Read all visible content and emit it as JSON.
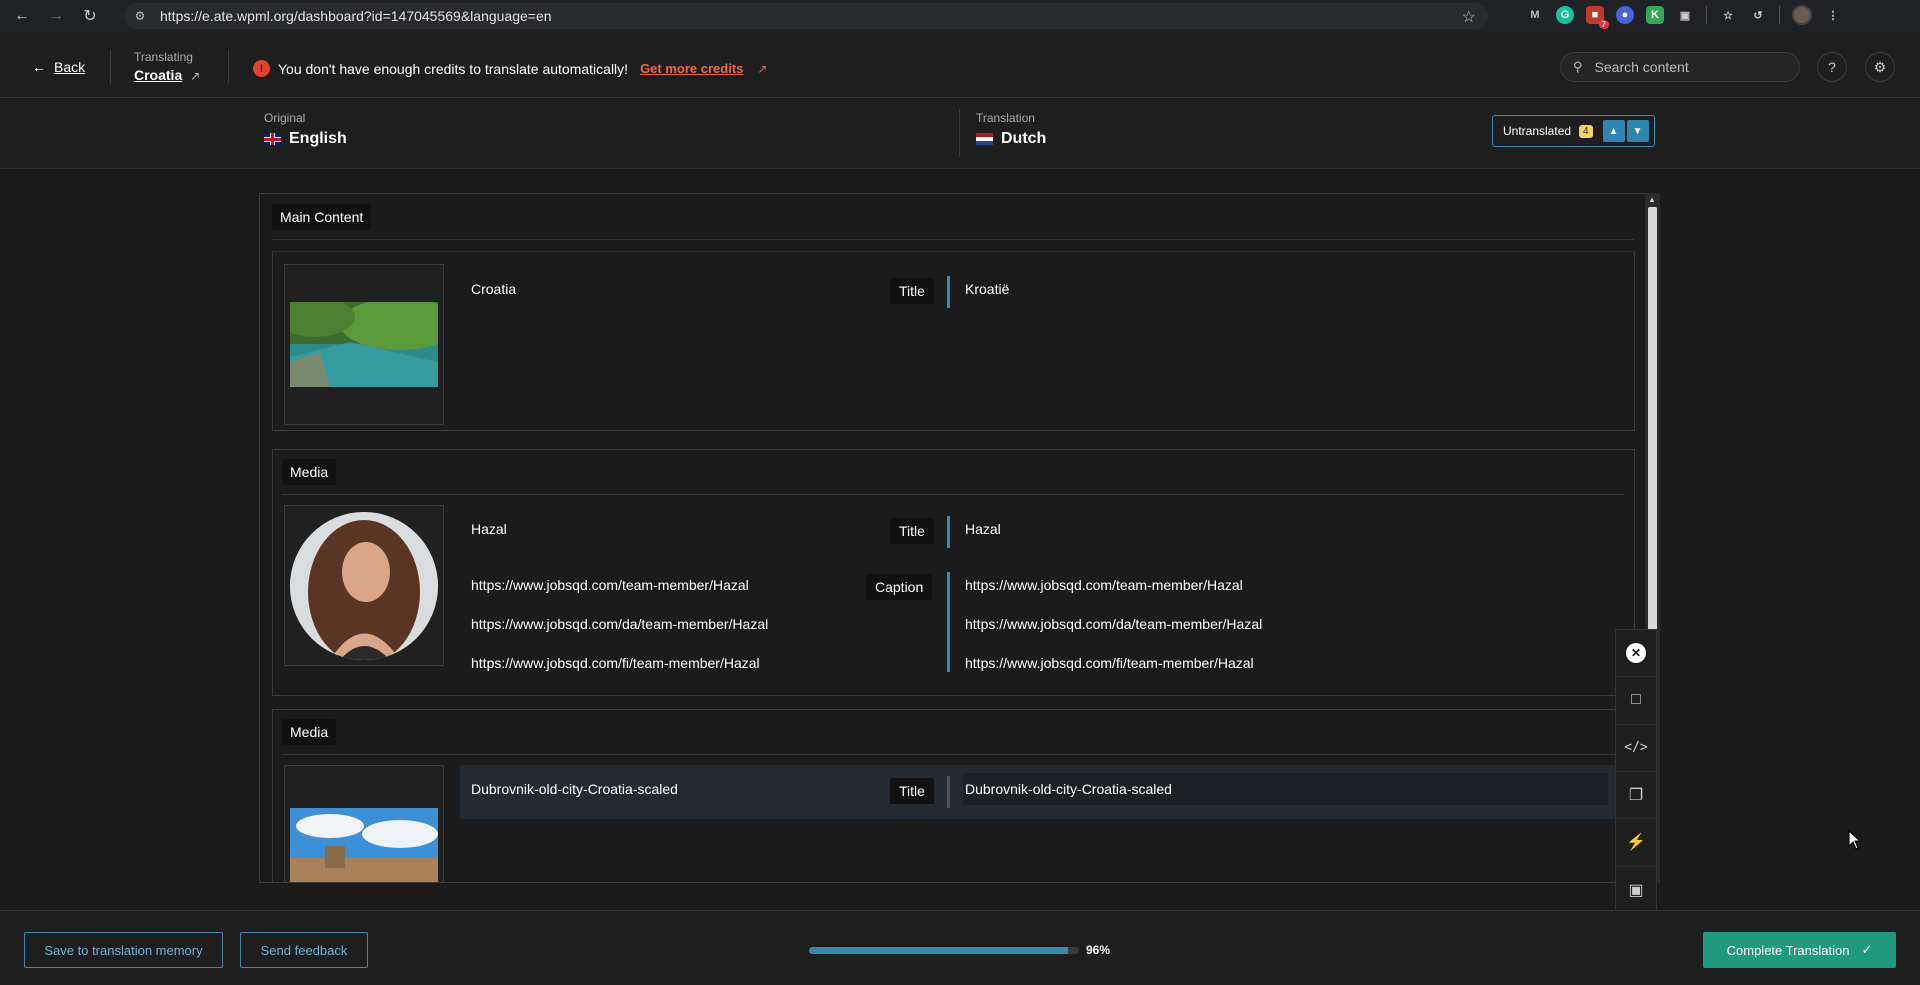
{
  "browser": {
    "url": "https://e.ate.wpml.org/dashboard?id=147045569&language=en",
    "ext_badge": "7"
  },
  "header": {
    "back_label": "Back",
    "translating_label": "Translating",
    "page_name": "Croatia",
    "credits_warning": "You don't have enough credits to translate automatically!",
    "credits_link": "Get more credits",
    "search_placeholder": "Search content"
  },
  "languages": {
    "original_label": "Original",
    "original_lang": "English",
    "translation_label": "Translation",
    "translation_lang": "Dutch",
    "untranslated_label": "Untranslated",
    "untranslated_count": "4"
  },
  "sections": {
    "main": {
      "tag": "Main Content",
      "title_tag": "Title",
      "source_title": "Croatia",
      "target_title": "Kroatië"
    },
    "media1": {
      "tag": "Media",
      "title_tag": "Title",
      "caption_tag": "Caption",
      "source_title": "Hazal",
      "target_title": "Hazal",
      "source_caption": [
        "https://www.jobsqd.com/team-member/Hazal",
        "https://www.jobsqd.com/da/team-member/Hazal",
        "https://www.jobsqd.com/fi/team-member/Hazal"
      ],
      "target_caption": [
        "https://www.jobsqd.com/team-member/Hazal",
        "https://www.jobsqd.com/da/team-member/Hazal",
        "https://www.jobsqd.com/fi/team-member/Hazal"
      ]
    },
    "media2": {
      "tag": "Media",
      "title_tag": "Title",
      "source_title": "Dubrovnik-old-city-Croatia-scaled",
      "target_title": "Dubrovnik-old-city-Croatia-scaled"
    }
  },
  "footer": {
    "save_memory_label": "Save to translation memory",
    "feedback_label": "Send feedback",
    "progress_percent": 96,
    "progress_label": "96%",
    "complete_label": "Complete Translation"
  },
  "colors": {
    "accent": "#3a8ab0",
    "complete": "#1f9a7d",
    "warning": "#e2432f",
    "link_orange": "#f2683f"
  }
}
